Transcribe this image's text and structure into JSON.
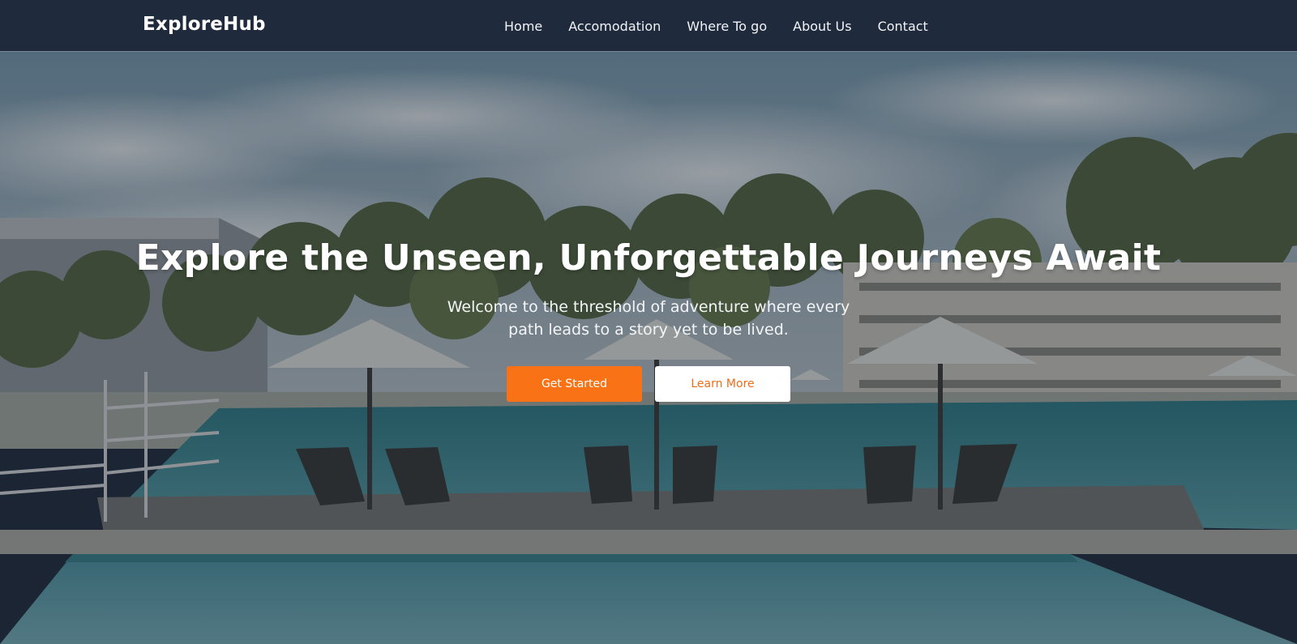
{
  "header": {
    "brand": "ExploreHub",
    "nav": [
      {
        "label": "Home"
      },
      {
        "label": "Accomodation"
      },
      {
        "label": "Where To go"
      },
      {
        "label": "About Us"
      },
      {
        "label": "Contact"
      }
    ]
  },
  "hero": {
    "title": "Explore the Unseen, Unforgettable Journeys Await",
    "subtitle": "Welcome to the threshold of adventure where every path leads to a story yet to be lived.",
    "primary_cta": "Get Started",
    "secondary_cta": "Learn More",
    "background_image": "resort-pool-with-umbrellas-and-lounge-chairs"
  },
  "colors": {
    "navbar": "#1f2a3c",
    "accent": "#f97316",
    "secondary_button": "#ffffff",
    "secondary_button_text": "#ea6d1a"
  }
}
